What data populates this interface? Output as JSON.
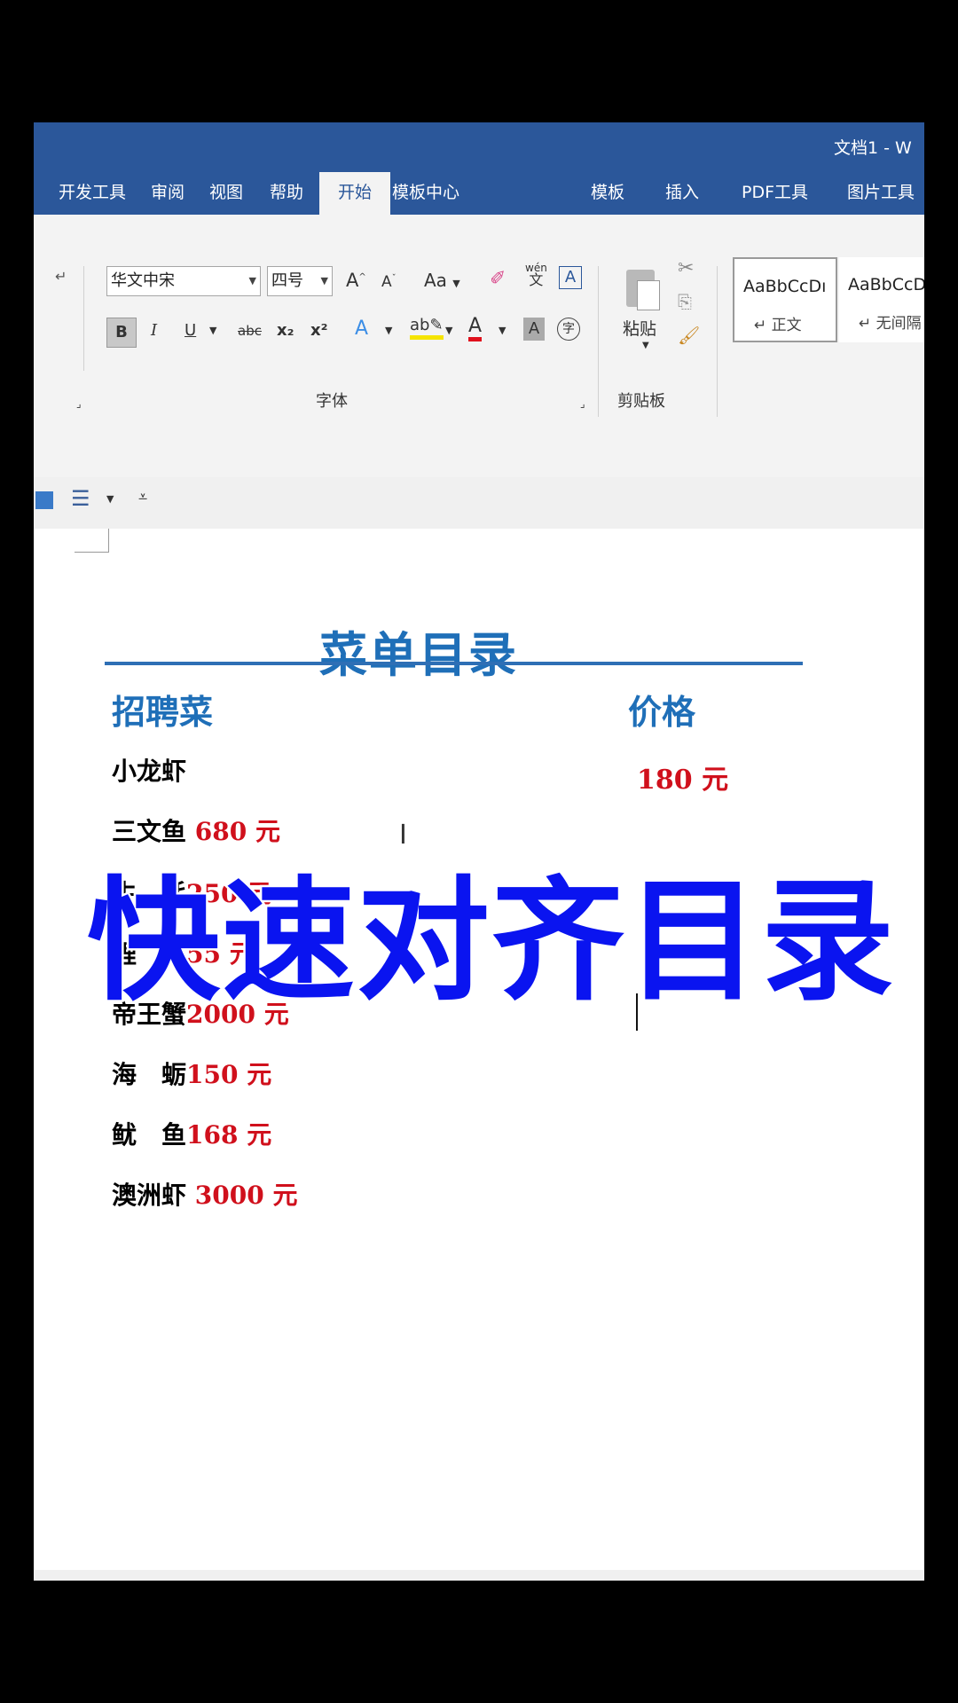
{
  "window": {
    "title": "文档1 - W"
  },
  "tabs": [
    "开发工具",
    "审阅",
    "视图",
    "帮助",
    "开始",
    "模板中心",
    "模板",
    "插入",
    "PDF工具",
    "图片工具"
  ],
  "ribbon": {
    "font_name": "华文中宋",
    "font_size": "四号",
    "font_group_label": "字体",
    "paste_label": "粘贴",
    "clipboard_group_label": "剪贴板",
    "case_button": "Aa",
    "bold": "B",
    "italic": "I",
    "underline": "U",
    "strike": "abc",
    "subscript": "x₂",
    "superscript": "x²",
    "grow_font": "A",
    "shrink_font": "A",
    "phonetic": "wén",
    "phonetic_char": "文",
    "border_char": "A",
    "shading_char": "A",
    "enclose_char": "字",
    "styles": [
      {
        "sample": "AaBbCcDı",
        "name": "↵ 正文"
      },
      {
        "sample": "AaBbCcD",
        "name": "↵ 无间隔"
      }
    ]
  },
  "document": {
    "title": "菜单目录",
    "col_dish": "招聘菜",
    "col_price": "价格",
    "first_item": {
      "name": "小龙虾",
      "price": "180 元"
    },
    "items": [
      {
        "name": "三文鱼",
        "price": " 680 元"
      },
      {
        "name": "生　蚝",
        "price": "250 元"
      },
      {
        "name": "鲤　鱼",
        "price": "55 元"
      },
      {
        "name": "帝王蟹",
        "price": "2000 元"
      },
      {
        "name": "海　蛎",
        "price": "150 元"
      },
      {
        "name": "鱿　鱼",
        "price": "168 元"
      },
      {
        "name": "澳洲虾",
        "price": " 3000 元"
      }
    ]
  },
  "overlay_caption": "快速对齐目录",
  "colors": {
    "ribbon_blue": "#2b579a",
    "heading_blue": "#1f6fb8",
    "price_red": "#d0101c",
    "caption_blue": "#0a14f0"
  }
}
